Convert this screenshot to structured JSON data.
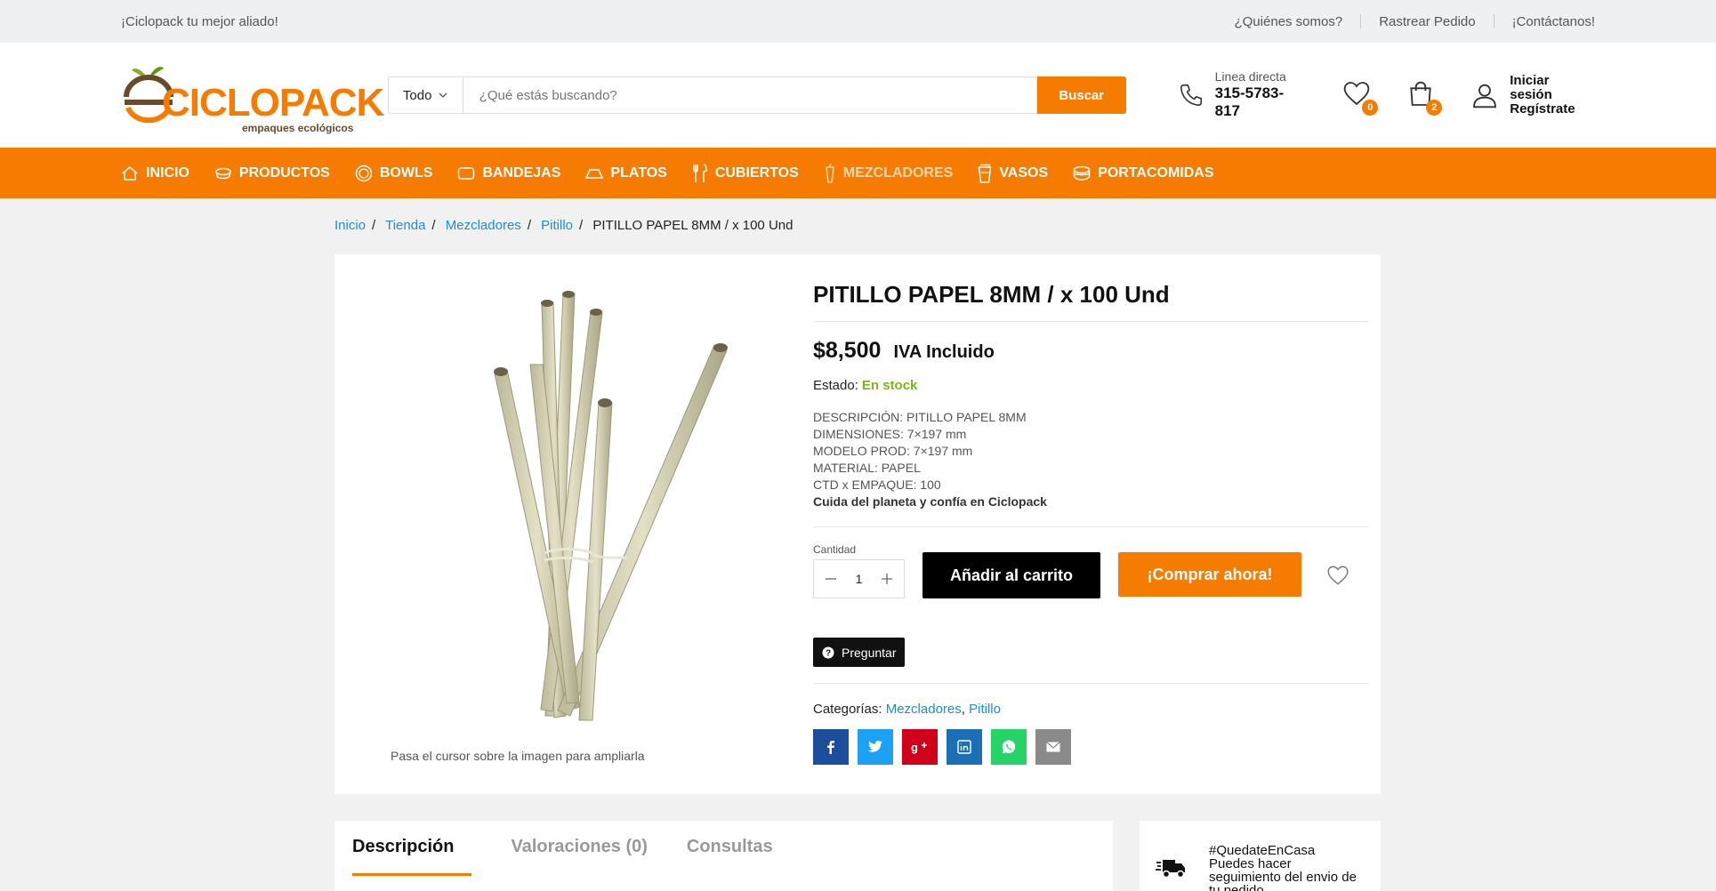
{
  "topbar": {
    "tagline": "¡Ciclopack tu mejor aliado!",
    "links": [
      "¿Quiénes somos?",
      "Rastrear Pedido",
      "¡Contáctanos!"
    ]
  },
  "header": {
    "logo_text": "CICLOPACK",
    "logo_sub": "empaques ecológicos",
    "search": {
      "category": "Todo",
      "placeholder": "¿Qué estás buscando?",
      "button": "Buscar"
    },
    "contact": {
      "label": "Linea directa",
      "phone": "315-5783-817"
    },
    "wishlist_count": "0",
    "cart_count": "2",
    "account": {
      "login": "Iniciar sesión",
      "register": "Regístrate"
    }
  },
  "nav": {
    "items": [
      "INICIO",
      "PRODUCTOS",
      "BOWLS",
      "BANDEJAS",
      "PLATOS",
      "CUBIERTOS",
      "MEZCLADORES",
      "VASOS",
      "PORTACOMIDAS"
    ]
  },
  "breadcrumb": [
    "Inicio",
    "Tienda",
    "Mezcladores",
    "Pitillo",
    "PITILLO PAPEL 8MM / x 100 Und"
  ],
  "product": {
    "title": "PITILLO PAPEL 8MM / x 100 Und",
    "price": "$8,500",
    "iva": "IVA Incluido",
    "stock_label": "Estado:",
    "stock_value": "En stock",
    "description": [
      "DESCRIPCIÓN: PITILLO PAPEL 8MM",
      "DIMENSIONES: 7×197 mm",
      "MODELO PROD: 7×197 mm",
      "MATERIAL: PAPEL",
      "CTD x EMPAQUE: 100"
    ],
    "tagline": "Cuida del planeta y confía en Ciclopack",
    "image_hint": "Pasa el cursor sobre la imagen para ampliarla",
    "quantity_label": "Cantidad",
    "quantity": "1",
    "add_to_cart": "Añadir al carrito",
    "buy_now": "¡Comprar ahora!",
    "ask": "Preguntar",
    "categories_label": "Categorías:",
    "categories": [
      "Mezcladores",
      "Pitillo"
    ],
    "share_colors": {
      "facebook": "#1d4e9b",
      "twitter": "#1da1f2",
      "googleplus": "#d0021b",
      "linkedin": "#1a6fb5",
      "whatsapp": "#25d366",
      "email": "#8a8a8a"
    }
  },
  "tabs": [
    "Descripción",
    "Valoraciones (0)",
    "Consultas"
  ],
  "side": {
    "text": "#QuedateEnCasa Puedes hacer seguimiento del envio de tu pedido"
  },
  "colors": {
    "accent": "#f57c00",
    "link": "#1a8fd1",
    "stock": "#7cb518"
  }
}
